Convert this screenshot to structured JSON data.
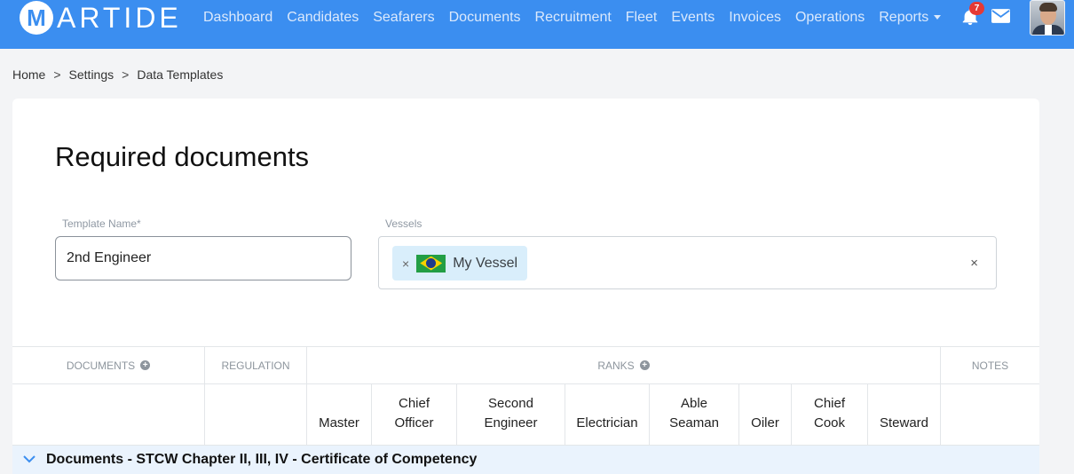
{
  "brand": {
    "name": "ARTIDE",
    "initial": "M"
  },
  "nav": {
    "items": [
      "Dashboard",
      "Candidates",
      "Seafarers",
      "Documents",
      "Recruitment",
      "Fleet",
      "Events",
      "Invoices",
      "Operations"
    ],
    "reports": "Reports",
    "notifications_count": "7"
  },
  "breadcrumb": [
    "Home",
    "Settings",
    "Data Templates"
  ],
  "page": {
    "title": "Required documents",
    "template_name_label": "Template Name*",
    "template_name_value": "2nd Engineer",
    "vessels_label": "Vessels",
    "vessel_tag": "My Vessel",
    "tag_remove": "×",
    "clear": "×"
  },
  "table": {
    "headers": {
      "documents": "Documents",
      "regulation": "Regulation",
      "ranks": "Ranks",
      "notes": "Notes"
    },
    "ranks": [
      "Master",
      "Chief\nOfficer",
      "Second\nEngineer",
      "Electrician",
      "Able\nSeaman",
      "Oiler",
      "Chief\nCook",
      "Steward"
    ],
    "section": "Documents - STCW Chapter II, III, IV - Certificate of Competency"
  },
  "colors": {
    "navbar": "#3b8ef0",
    "section_bg": "#eaf3fd",
    "badge": "#e53935",
    "tag_bg": "#d9eefb"
  }
}
